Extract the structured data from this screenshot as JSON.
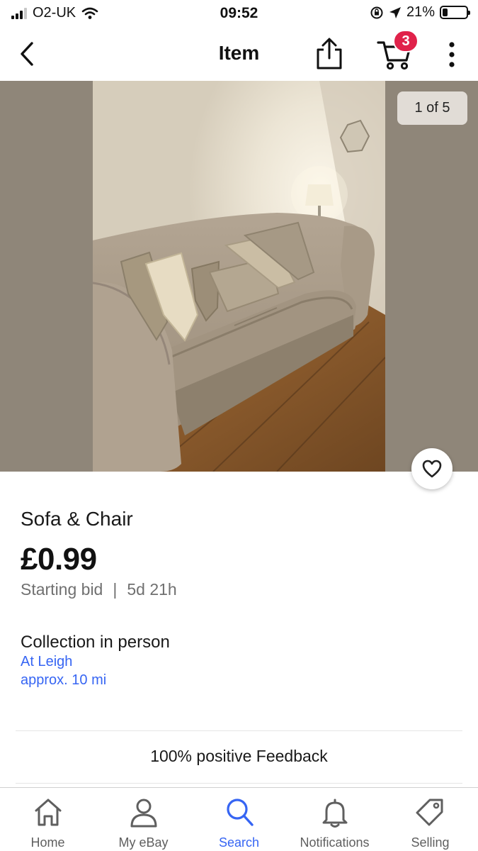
{
  "status_bar": {
    "carrier": "O2-UK",
    "time": "09:52",
    "battery": "21%",
    "battery_level": 0.21
  },
  "nav": {
    "title": "Item",
    "cart_count": "3",
    "icons": [
      "back-arrow-icon",
      "share-icon",
      "cart-icon",
      "more-icon"
    ]
  },
  "gallery": {
    "counter": "1 of 5",
    "icons": [
      "heart-icon"
    ]
  },
  "item": {
    "title": "Sofa & Chair",
    "price": "£0.99",
    "bid_label": "Starting bid",
    "separator": "|",
    "time_left": "5d 21h",
    "collection": "Collection in person",
    "location": "At Leigh",
    "distance": "approx. 10 mi",
    "feedback": "100% positive Feedback"
  },
  "tabs": [
    {
      "label": "Home",
      "icon": "home-icon",
      "active": false
    },
    {
      "label": "My eBay",
      "icon": "user-icon",
      "active": false
    },
    {
      "label": "Search",
      "icon": "search-icon",
      "active": true
    },
    {
      "label": "Notifications",
      "icon": "bell-icon",
      "active": false
    },
    {
      "label": "Selling",
      "icon": "tag-icon",
      "active": false
    }
  ],
  "colors": {
    "link": "#3665f3",
    "badge": "#e0224a",
    "gallery_bg": "#8f8679"
  }
}
